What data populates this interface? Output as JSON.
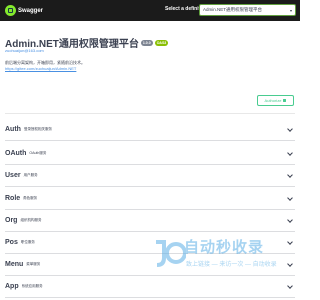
{
  "header": {
    "logo_text": "Swagger",
    "definition_label": "Select a definition",
    "definition_value": "Admin.NET通用权限管理平台"
  },
  "info": {
    "title": "Admin.NET通用权限管理平台",
    "version_badge": "1.0.0",
    "oas_badge": "OAS3",
    "email": "zuohuaijun@163.com",
    "description": "前后端分离架构，开箱即用，紧随前沿技术。",
    "link": "https://gitee.com/zuohuaijun/Admin.NET"
  },
  "authorize": {
    "label": "Authorize"
  },
  "tags": [
    {
      "name": "Auth",
      "description": "登录授权相关服务"
    },
    {
      "name": "OAuth",
      "description": "OAuth服务"
    },
    {
      "name": "User",
      "description": "用户服务"
    },
    {
      "name": "Role",
      "description": "角色服务"
    },
    {
      "name": "Org",
      "description": "组织机构服务"
    },
    {
      "name": "Pos",
      "description": "职位服务"
    },
    {
      "name": "Menu",
      "description": "菜单服务"
    },
    {
      "name": "App",
      "description": "系统应用服务"
    }
  ],
  "watermark": {
    "main": "自动秒收录",
    "sub": "致上链接 — 来访一次 — 自动收录"
  }
}
